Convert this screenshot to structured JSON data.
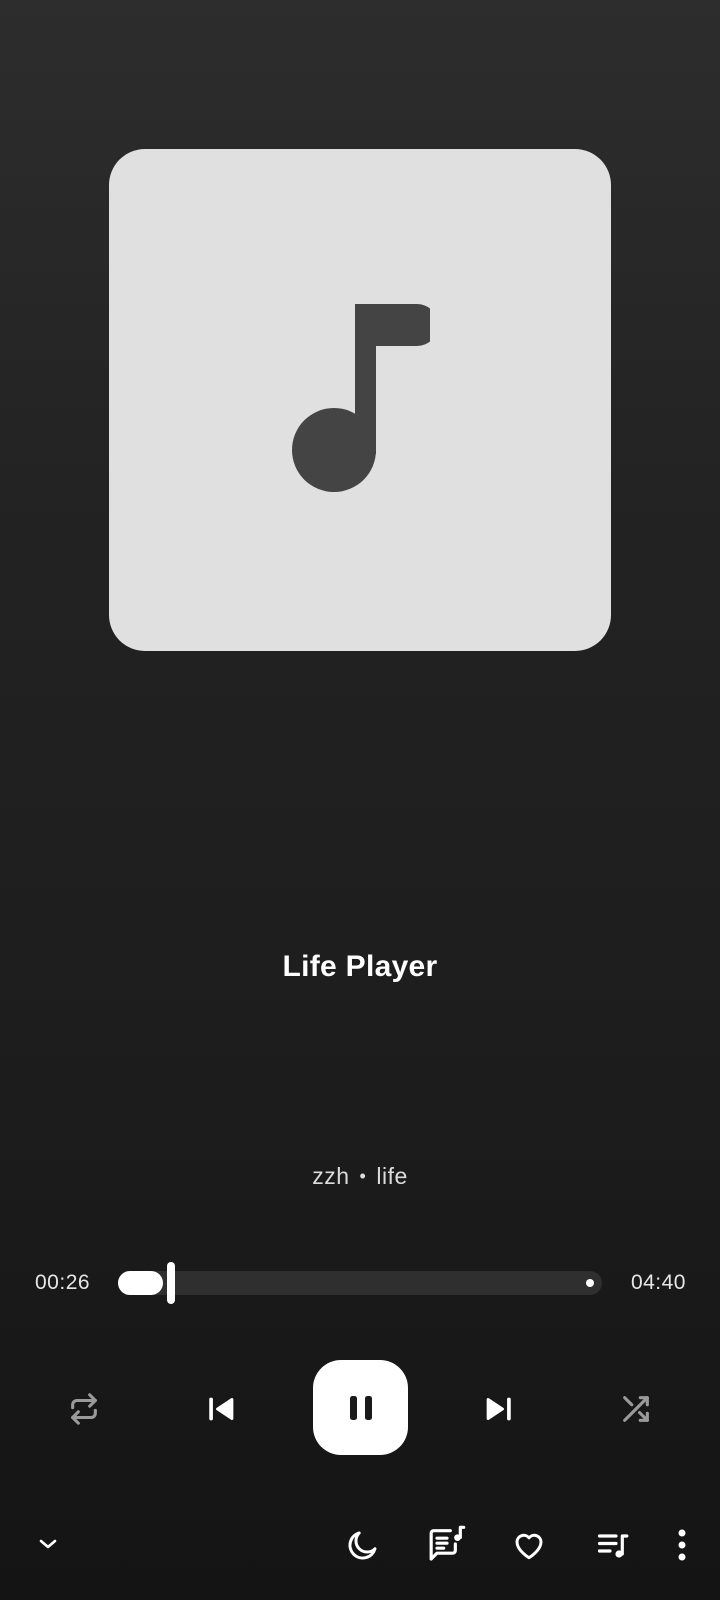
{
  "track": {
    "title": "Life Player",
    "artist": "zzh",
    "separator": "•",
    "album": "life"
  },
  "artwork": {
    "icon": "music-note-icon",
    "background": "#e0e0e0",
    "icon_color": "#444444"
  },
  "playback": {
    "elapsed": "00:26",
    "duration": "04:40",
    "progress_fraction": 0.093,
    "state": "playing"
  },
  "controls": {
    "repeat": "repeat-icon",
    "previous": "skip-previous-icon",
    "play_pause": "pause-icon",
    "next": "skip-next-icon",
    "shuffle": "shuffle-icon"
  },
  "bottom_bar": {
    "collapse": "chevron-down-icon",
    "sleep_timer": "moon-icon",
    "lyrics": "lyrics-icon",
    "favorite": "heart-outline-icon",
    "queue": "queue-music-icon",
    "more": "more-vertical-icon"
  }
}
